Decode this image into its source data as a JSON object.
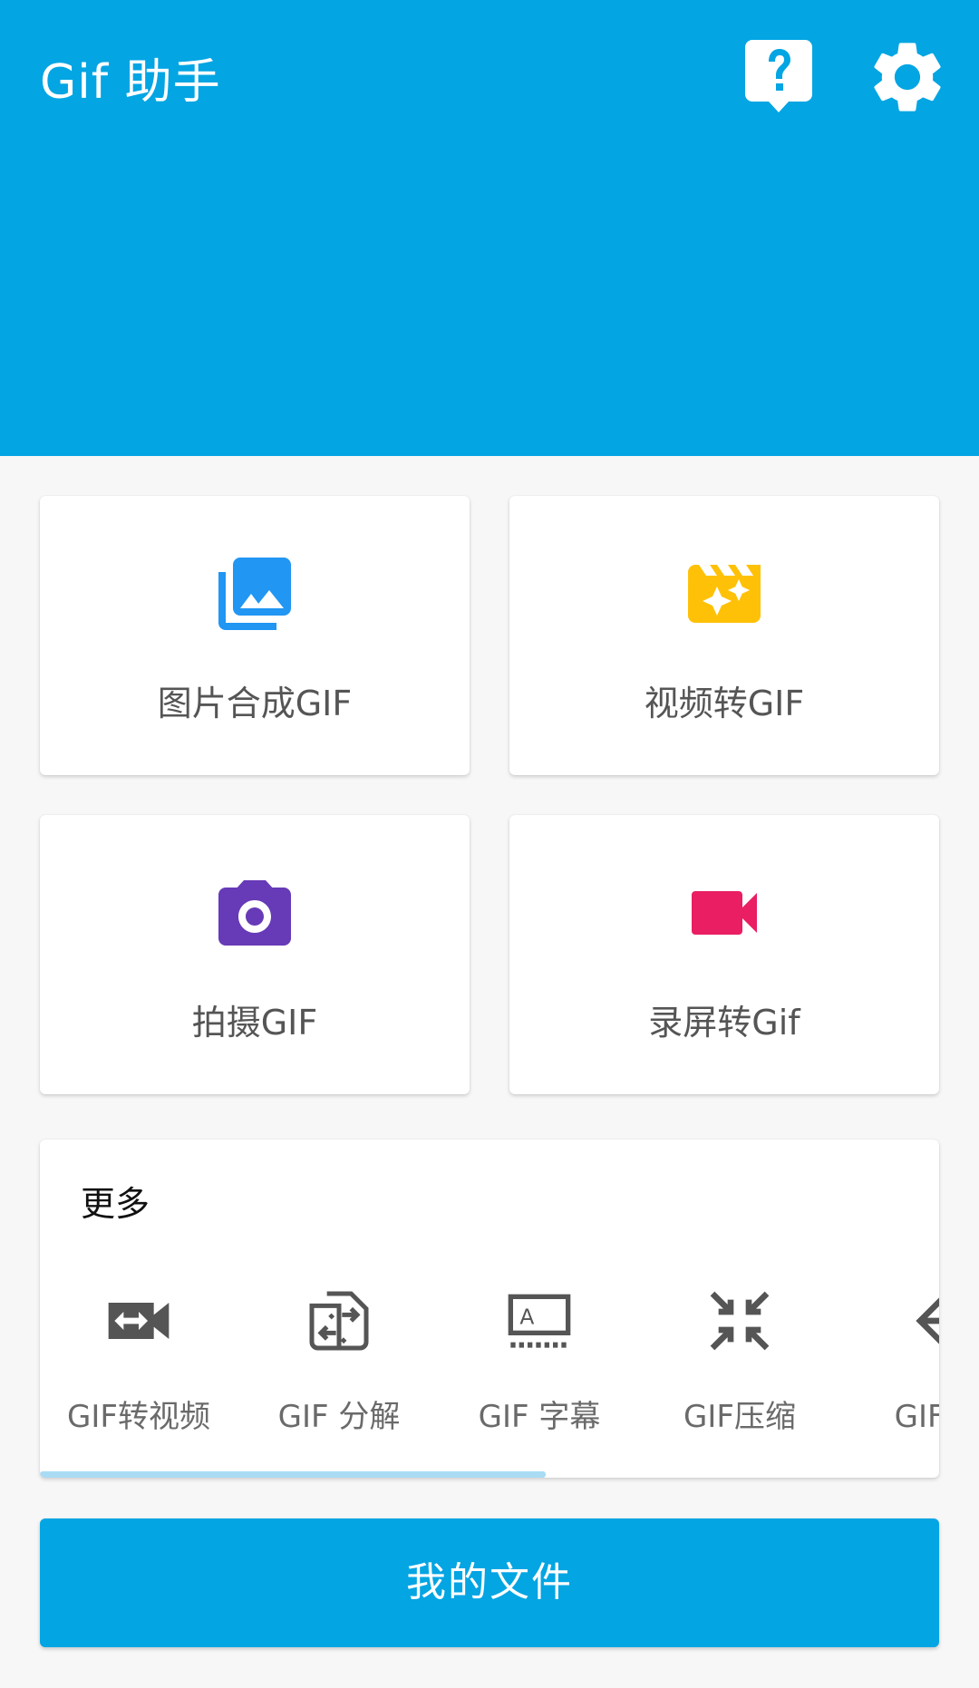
{
  "app": {
    "title": "Gif 助手",
    "accent_color": "#03a5e3",
    "help_icon": "help-bubble-icon",
    "settings_icon": "gear-icon"
  },
  "cards": [
    {
      "label": "图片合成GIF",
      "icon": "photo-library-icon",
      "color": "#2196f3"
    },
    {
      "label": "视频转GIF",
      "icon": "movie-filter-icon",
      "color": "#ffc107"
    },
    {
      "label": "拍摄GIF",
      "icon": "camera-icon",
      "color": "#673ab7"
    },
    {
      "label": "录屏转Gif",
      "icon": "videocam-icon",
      "color": "#e91e63"
    }
  ],
  "more": {
    "title": "更多",
    "tools": [
      {
        "label": "GIF转视频",
        "icon": "gif-to-video-icon"
      },
      {
        "label": "GIF 分解",
        "icon": "split-file-icon"
      },
      {
        "label": "GIF 字幕",
        "icon": "subtitles-icon"
      },
      {
        "label": "GIF压缩",
        "icon": "compress-icon"
      },
      {
        "label": "GIF 倒",
        "icon": "arrow-left-icon"
      }
    ],
    "scroll_fraction_visible": 0.56
  },
  "footer": {
    "files_label": "我的文件"
  }
}
